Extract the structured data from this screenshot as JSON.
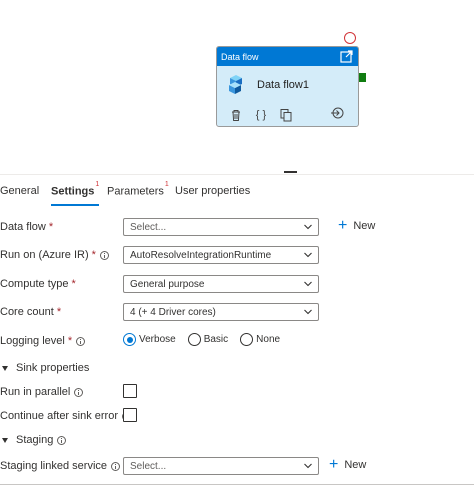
{
  "activity": {
    "header": "Data flow",
    "name": "Data flow1",
    "icons": [
      "open-icon",
      "delete-icon",
      "code-icon",
      "copy-icon",
      "connect-icon",
      "dataflow-icon"
    ]
  },
  "tabs": [
    {
      "label": "General",
      "badge": ""
    },
    {
      "label": "Settings",
      "badge": "1"
    },
    {
      "label": "Parameters",
      "badge": "1"
    },
    {
      "label": "User properties",
      "badge": ""
    }
  ],
  "form": {
    "data_flow": {
      "label": "Data flow",
      "value": "Select..."
    },
    "new_label": "New",
    "run_on": {
      "label": "Run on (Azure IR)",
      "value": "AutoResolveIntegrationRuntime"
    },
    "compute_type": {
      "label": "Compute type",
      "value": "General purpose"
    },
    "core_count": {
      "label": "Core count",
      "value": "4 (+ 4 Driver cores)"
    },
    "logging_level": {
      "label": "Logging level",
      "options": [
        "Verbose",
        "Basic",
        "None"
      ],
      "selected": "Verbose"
    },
    "sink_properties": {
      "label": "Sink properties"
    },
    "run_in_parallel": {
      "label": "Run in parallel",
      "checked": false
    },
    "continue_after_error": {
      "label": "Continue after sink error",
      "checked": false
    },
    "staging": {
      "label": "Staging"
    },
    "staging_linked_service": {
      "label": "Staging linked service",
      "value": "Select..."
    }
  },
  "colors": {
    "accent": "#0078d4",
    "card": "#d4ecf9",
    "error": "#d13438",
    "port": "#107c10"
  }
}
